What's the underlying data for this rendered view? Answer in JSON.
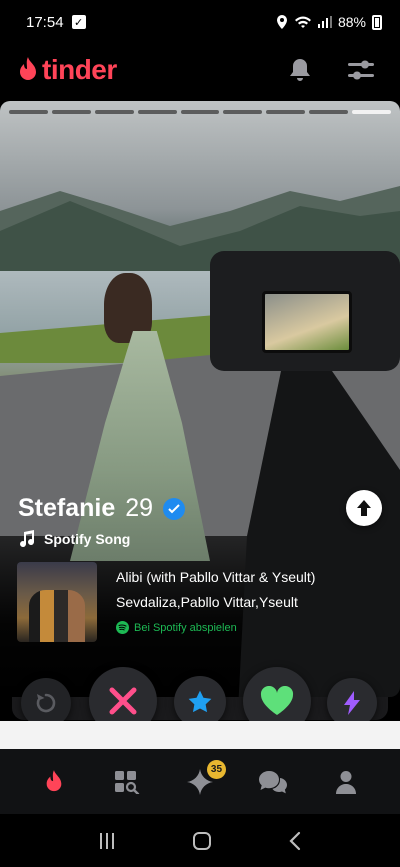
{
  "status_bar": {
    "time": "17:54",
    "battery": "88%"
  },
  "header": {
    "app_name": "tinder",
    "brand_color": "#ff4458"
  },
  "card": {
    "photo_count": 9,
    "active_photo_index": 8,
    "name": "Stefanie",
    "age": "29",
    "verified": true,
    "song_section_label": "Spotify Song",
    "track": {
      "title": "Alibi (with Pabllo Vittar & Yseult)",
      "artists": "Sevdaliza,Pabllo Vittar,Yseult",
      "play_label": "Bei Spotify abspielen"
    }
  },
  "actions": {
    "rewind": "rewind-icon",
    "nope": "x-icon",
    "super_like": "star-icon",
    "like": "heart-icon",
    "boost": "lightning-icon",
    "colors": {
      "nope": "#ff4f8b",
      "super_like": "#1fa0f2",
      "like": "#5ee07a",
      "boost": "#a05cff"
    }
  },
  "bottom_nav": {
    "items": [
      "flame-icon",
      "explore-icon",
      "sparkle-icon",
      "chat-icon",
      "profile-icon"
    ],
    "sparkle_badge": "35"
  }
}
